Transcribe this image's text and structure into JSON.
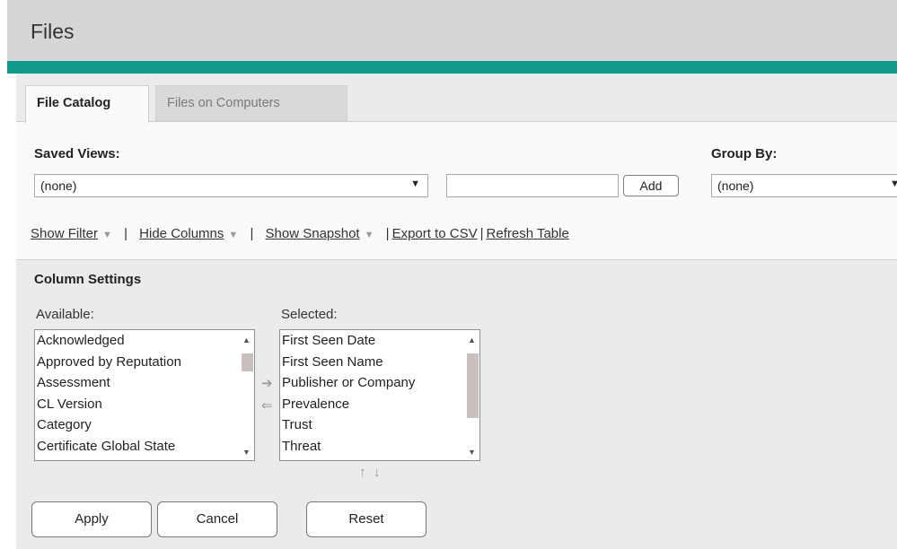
{
  "header": {
    "title": "Files"
  },
  "tabs": [
    {
      "label": "File Catalog",
      "active": true
    },
    {
      "label": "Files on Computers",
      "active": false
    }
  ],
  "filters": {
    "saved_views_label": "Saved Views:",
    "saved_views_value": "(none)",
    "view_name_value": "",
    "add_label": "Add",
    "group_by_label": "Group By:",
    "group_by_value": "(none)"
  },
  "toolbar": {
    "show_filter": "Show Filter",
    "hide_columns": "Hide Columns",
    "show_snapshot": "Show Snapshot",
    "export_csv": "Export to CSV",
    "refresh_table": "Refresh Table"
  },
  "column_settings": {
    "title": "Column Settings",
    "available_label": "Available:",
    "selected_label": "Selected:",
    "available": [
      "Acknowledged",
      "Approved by Reputation",
      "Assessment",
      "CL Version",
      "Category",
      "Certificate Global State"
    ],
    "selected": [
      "First Seen Date",
      "First Seen Name",
      "Publisher or Company",
      "Prevalence",
      "Trust",
      "Threat"
    ]
  },
  "buttons": {
    "apply": "Apply",
    "cancel": "Cancel",
    "reset": "Reset"
  },
  "colors": {
    "accent": "#109a8c",
    "header_bg": "#d6d6d6",
    "panel_bg": "#ecebec"
  }
}
